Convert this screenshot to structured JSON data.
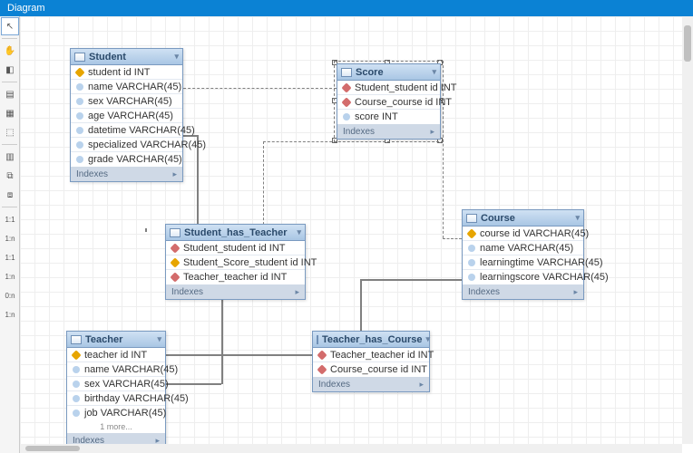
{
  "titlebar": "Diagram",
  "idx_label": "Indexes",
  "tables": {
    "student": {
      "title": "Student",
      "cols": [
        {
          "k": "key",
          "t": "student id INT"
        },
        {
          "k": "col",
          "t": "name VARCHAR(45)"
        },
        {
          "k": "col",
          "t": "sex VARCHAR(45)"
        },
        {
          "k": "col",
          "t": "age VARCHAR(45)"
        },
        {
          "k": "col",
          "t": "datetime VARCHAR(45)"
        },
        {
          "k": "col",
          "t": "specialized VARCHAR(45)"
        },
        {
          "k": "col",
          "t": "grade VARCHAR(45)"
        }
      ]
    },
    "score": {
      "title": "Score",
      "cols": [
        {
          "k": "fk",
          "t": "Student_student id INT"
        },
        {
          "k": "fk",
          "t": "Course_course id INT"
        },
        {
          "k": "col",
          "t": "score INT"
        }
      ]
    },
    "course": {
      "title": "Course",
      "cols": [
        {
          "k": "key",
          "t": "course id VARCHAR(45)"
        },
        {
          "k": "col",
          "t": "name VARCHAR(45)"
        },
        {
          "k": "col",
          "t": "learningtime VARCHAR(45)"
        },
        {
          "k": "col",
          "t": "learningscore VARCHAR(45)"
        }
      ]
    },
    "sht": {
      "title": "Student_has_Teacher",
      "cols": [
        {
          "k": "fk",
          "t": "Student_student id INT"
        },
        {
          "k": "key",
          "t": "Student_Score_student id INT"
        },
        {
          "k": "fk",
          "t": "Teacher_teacher id INT"
        }
      ]
    },
    "teacher": {
      "title": "Teacher",
      "cols": [
        {
          "k": "key",
          "t": "teacher id INT"
        },
        {
          "k": "col",
          "t": "name VARCHAR(45)"
        },
        {
          "k": "col",
          "t": "sex VARCHAR(45)"
        },
        {
          "k": "col",
          "t": "birthday VARCHAR(45)"
        },
        {
          "k": "col",
          "t": "job VARCHAR(45)"
        }
      ],
      "more": "1 more..."
    },
    "thc": {
      "title": "Teacher_has_Course",
      "cols": [
        {
          "k": "fk",
          "t": "Teacher_teacher id INT"
        },
        {
          "k": "fk",
          "t": "Course_course id INT"
        }
      ]
    }
  },
  "rel_labels": {
    "11": "1:1",
    "1n": "1:n",
    "0n": "0:n"
  }
}
